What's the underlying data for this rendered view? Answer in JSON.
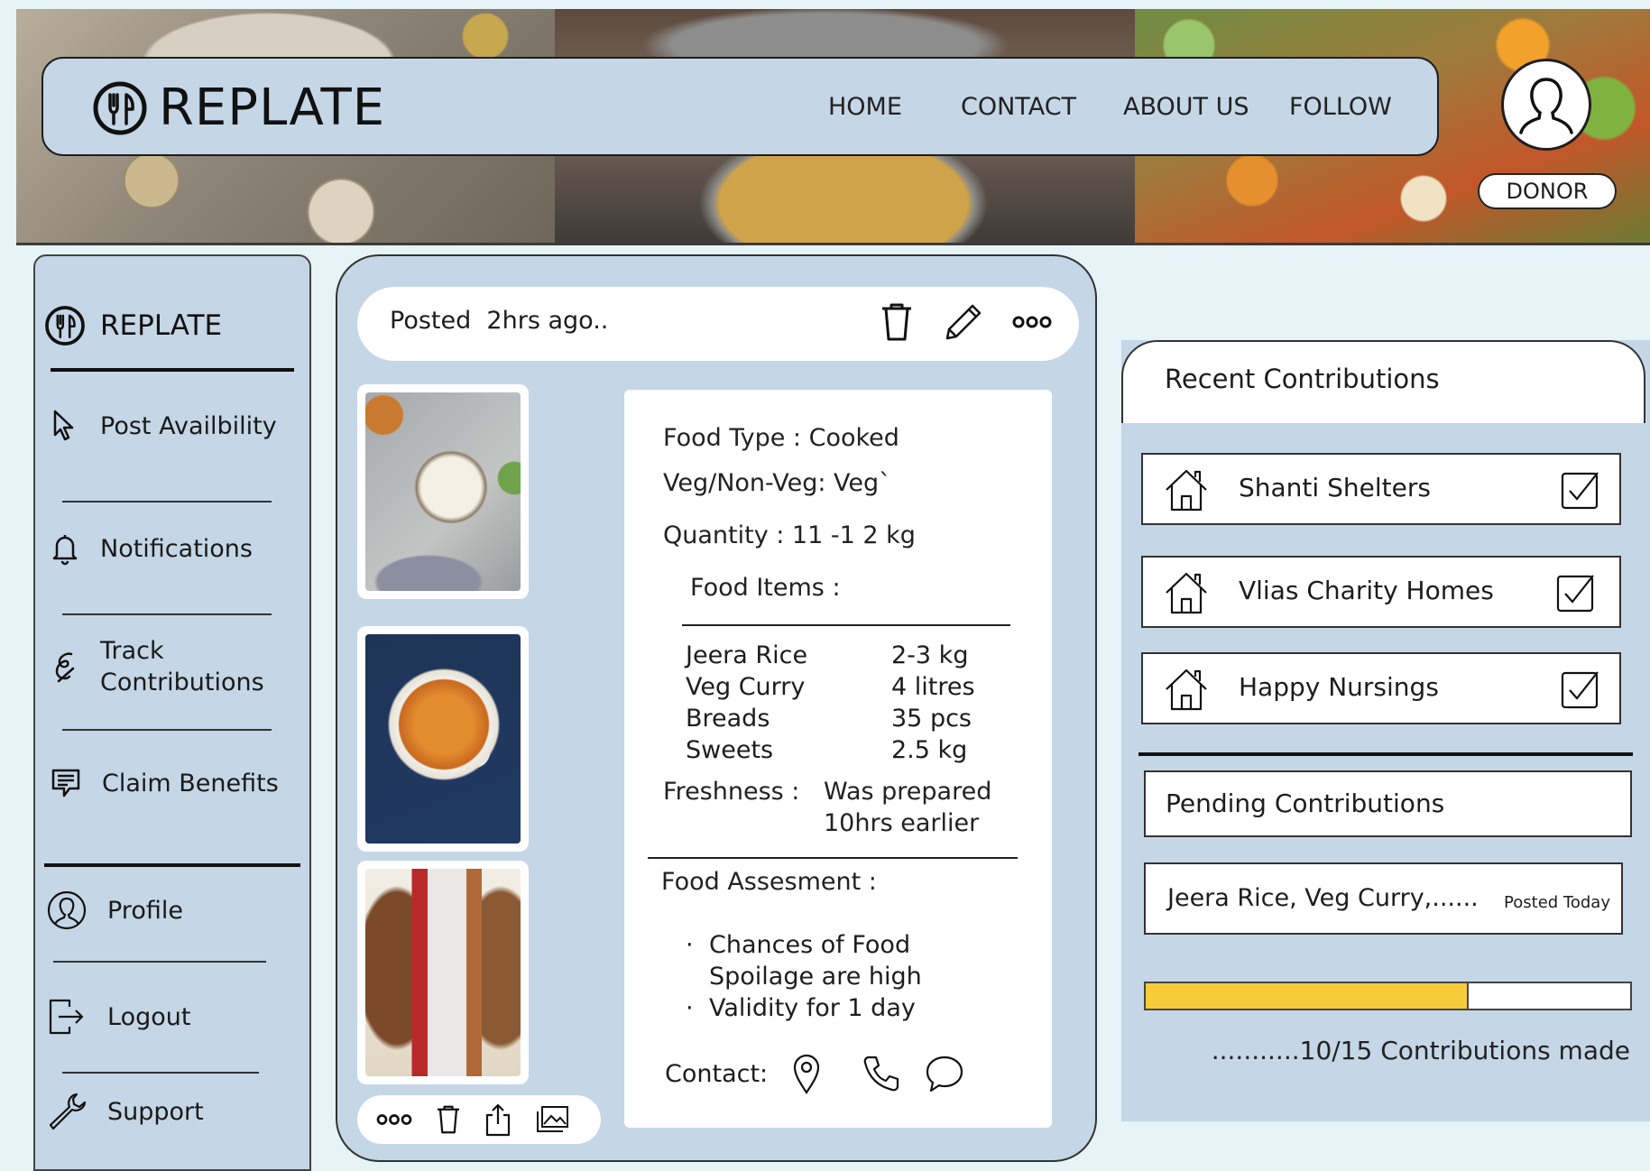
{
  "header": {
    "brand": "REPLATE",
    "nav": [
      "HOME",
      "CONTACT",
      "ABOUT US",
      "FOLLOW"
    ],
    "role_badge": "DONOR"
  },
  "sidebar": {
    "brand": "REPLATE",
    "items": [
      {
        "label": "Post Availbility",
        "icon": "cursor-icon"
      },
      {
        "label": "Notifications",
        "icon": "bell-icon"
      },
      {
        "label": "Track Contributions",
        "icon": "track-icon"
      },
      {
        "label": "Claim Benefits",
        "icon": "receipt-icon"
      },
      {
        "label": "Profile",
        "icon": "profile-icon"
      },
      {
        "label": "Logout",
        "icon": "logout-icon"
      },
      {
        "label": "Support",
        "icon": "wrench-icon"
      }
    ]
  },
  "post": {
    "posted_label": "Posted",
    "posted_time": "2hrs ago..",
    "food_type": "Food Type : Cooked",
    "veg": "Veg/Non-Veg: Veg`",
    "quantity": "Quantity  :  11 -1 2 kg",
    "items_heading": "Food Items :",
    "items": [
      {
        "name": "Jeera Rice",
        "qty": "2-3 kg"
      },
      {
        "name": "Veg Curry",
        "qty": "4 litres"
      },
      {
        "name": "Breads",
        "qty": "35 pcs"
      },
      {
        "name": "Sweets",
        "qty": "2.5 kg"
      }
    ],
    "freshness_label": "Freshness :",
    "freshness_value_1": "Was prepared",
    "freshness_value_2": "10hrs earlier",
    "assessment_heading": "Food Assesment :",
    "assessment": [
      "Chances of Food",
      "Spoilage are high",
      "Validity for 1 day"
    ],
    "contact_label": "Contact:"
  },
  "recent": {
    "title": "Recent Contributions",
    "items": [
      "Shanti Shelters",
      "Vlias Charity Homes",
      "Happy Nursings"
    ]
  },
  "pending": {
    "title": "Pending Contributions",
    "item": "Jeera Rice, Veg Curry,......",
    "item_status": "Posted  Today",
    "made": 10,
    "total": 15,
    "progress_text": "...........10/15 Contributions made"
  },
  "colors": {
    "panel": "#c5d6e6",
    "background": "#e6f3f7",
    "progress": "#f6cd38"
  }
}
